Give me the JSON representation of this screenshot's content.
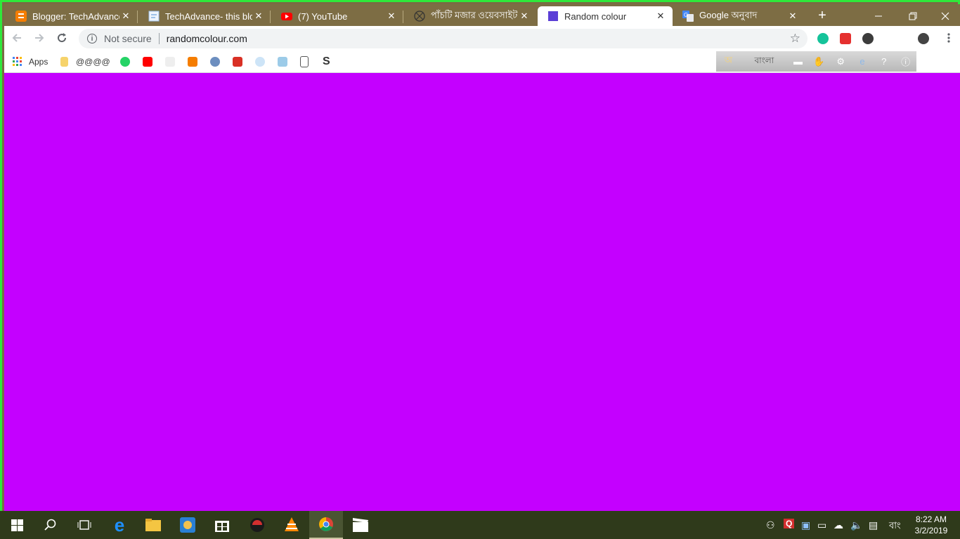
{
  "tabs": [
    {
      "title": "Blogger: TechAdvance-",
      "favicon": "blogger-icon",
      "color": "#f57d00",
      "active": false
    },
    {
      "title": "TechAdvance- this blog",
      "favicon": "page-icon",
      "color": "#9ec1e8",
      "active": false
    },
    {
      "title": "(7) YouTube",
      "favicon": "youtube-icon",
      "color": "#ff0000",
      "active": false
    },
    {
      "title": "পাঁচটি মজার ওয়েবসাইট",
      "favicon": "globe-icon",
      "color": "#333333",
      "active": false
    },
    {
      "title": "Random colour",
      "favicon": "square-icon",
      "color": "#5b3fd6",
      "active": true
    },
    {
      "title": "Google অনুবাদ",
      "favicon": "translate-icon",
      "color": "#4285f4",
      "active": false
    }
  ],
  "toolbar": {
    "security_label": "Not secure",
    "url": "randomcolour.com"
  },
  "bookmarks": {
    "apps_label": "Apps",
    "folder_label": "@@@@",
    "bangla_label": "বাংলা"
  },
  "page": {
    "background_color": "#c400ff"
  },
  "taskbar": {
    "time": "8:22 AM",
    "date": "3/2/2019",
    "language": "বাং"
  },
  "colors": {
    "frame_border": "#2fe83a",
    "tab_strip": "#7d6d44",
    "taskbar": "#2f3a1b"
  }
}
